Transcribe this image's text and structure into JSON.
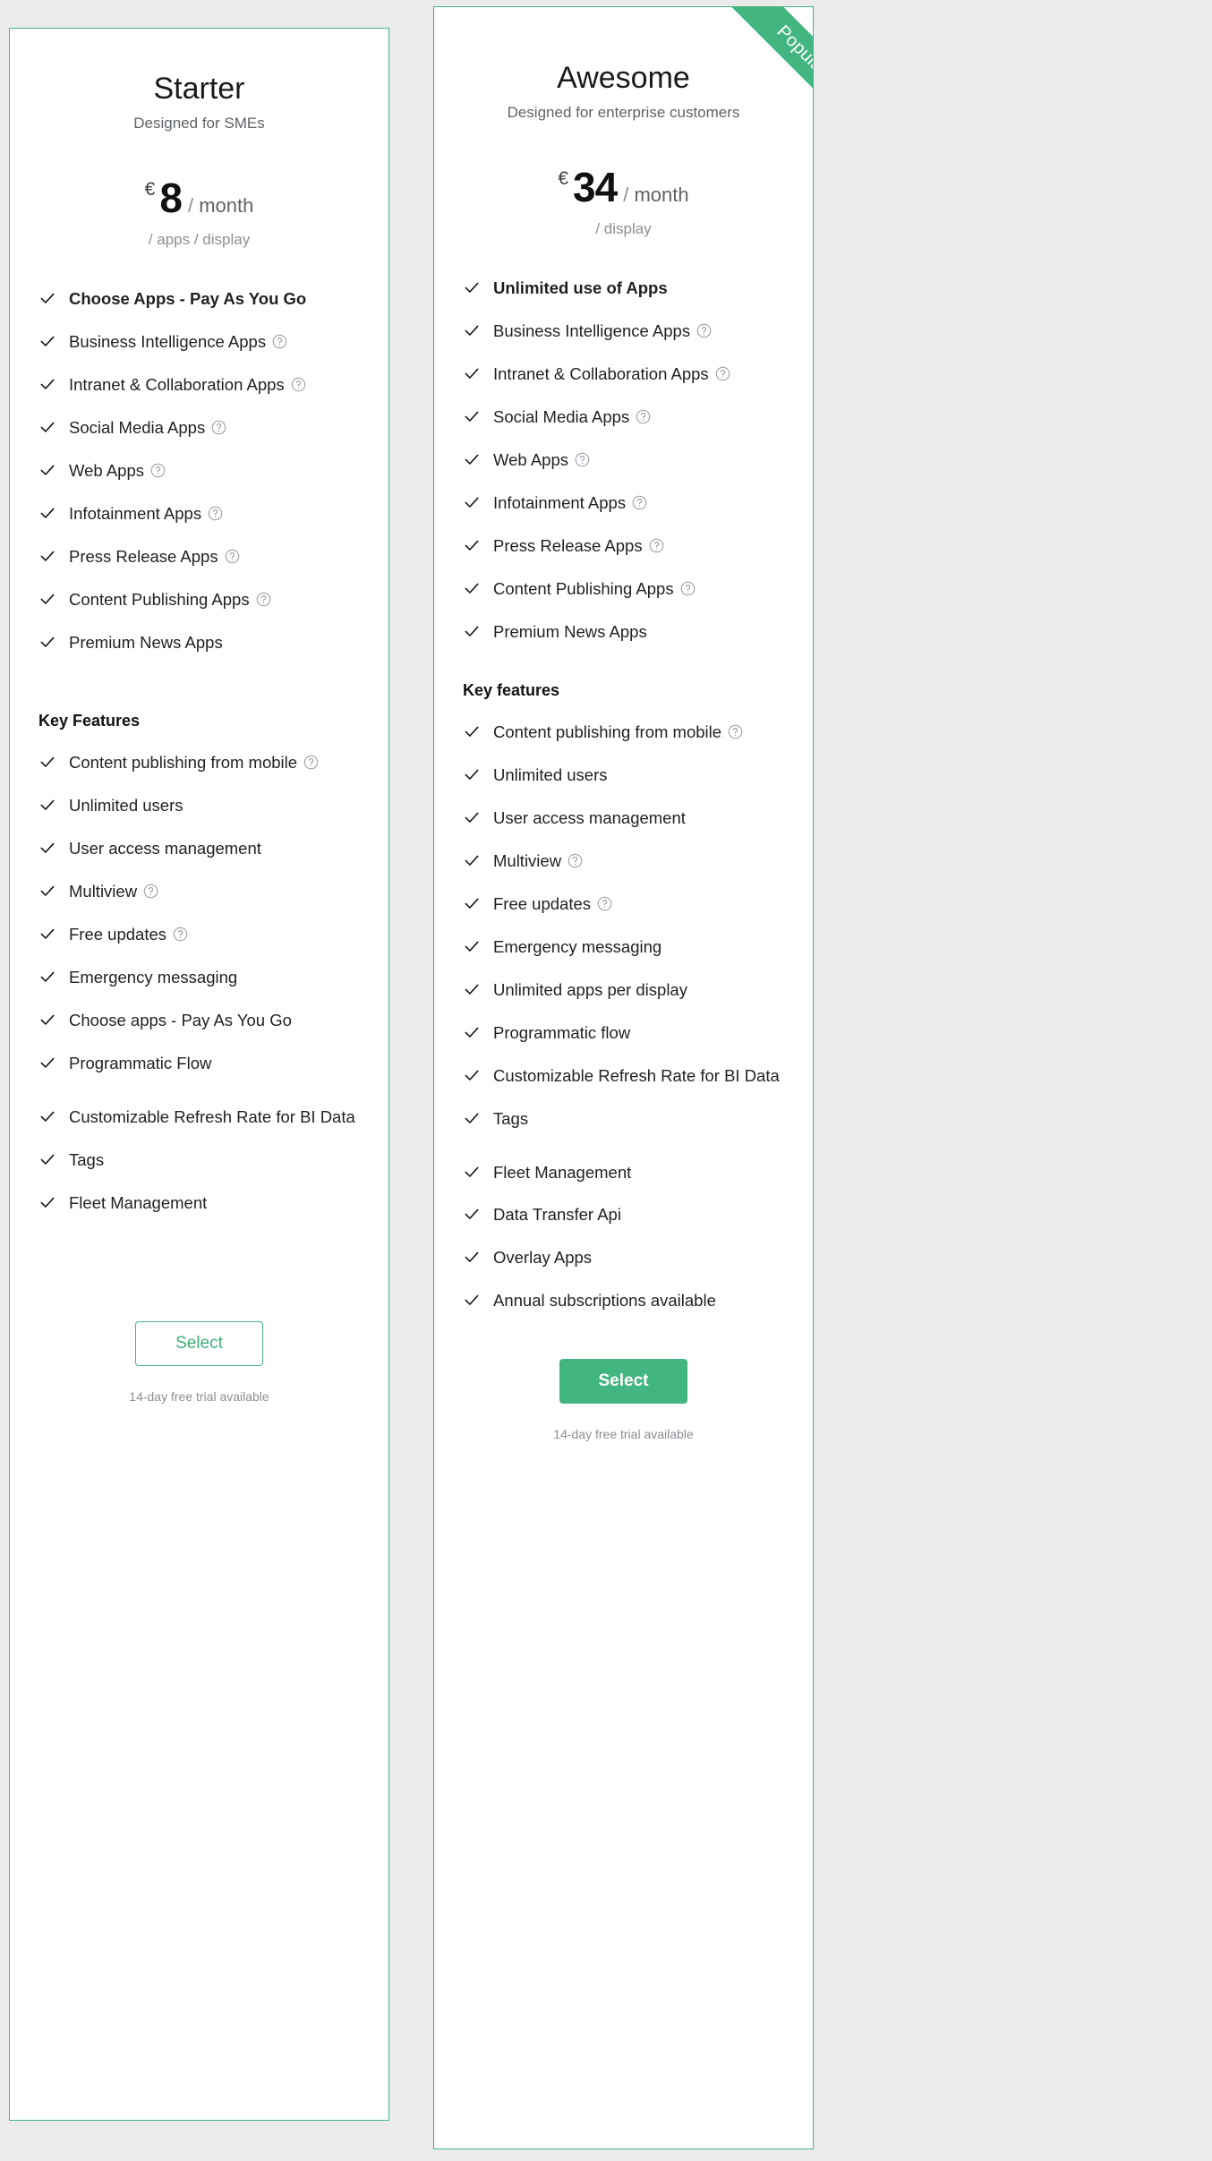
{
  "page": {
    "background_color": "#ebebeb",
    "accent_color": "#43b581"
  },
  "plans": [
    {
      "id": "starter",
      "name": "Starter",
      "tagline": "Designed for SMEs",
      "ribbon": null,
      "price": {
        "currency": "€",
        "amount": "8",
        "slash": "/",
        "period": "month",
        "note": "/ apps / display"
      },
      "apps_section": {
        "title": null,
        "items": [
          {
            "label": "Choose Apps - Pay As You Go",
            "bold": true,
            "help": false,
            "gap_before": false
          },
          {
            "label": "Business Intelligence Apps",
            "bold": false,
            "help": true,
            "gap_before": false
          },
          {
            "label": "Intranet & Collaboration Apps",
            "bold": false,
            "help": true,
            "gap_before": false
          },
          {
            "label": "Social Media Apps",
            "bold": false,
            "help": true,
            "gap_before": false
          },
          {
            "label": "Web Apps",
            "bold": false,
            "help": true,
            "gap_before": false
          },
          {
            "label": "Infotainment Apps",
            "bold": false,
            "help": true,
            "gap_before": false
          },
          {
            "label": "Press Release Apps",
            "bold": false,
            "help": true,
            "gap_before": false
          },
          {
            "label": "Content Publishing Apps",
            "bold": false,
            "help": true,
            "gap_before": false
          },
          {
            "label": "Premium News Apps",
            "bold": false,
            "help": false,
            "gap_before": false
          }
        ]
      },
      "features_section": {
        "title": "Key Features",
        "items": [
          {
            "label": "Content publishing from mobile",
            "bold": false,
            "help": true,
            "gap_before": false
          },
          {
            "label": "Unlimited users",
            "bold": false,
            "help": false,
            "gap_before": false
          },
          {
            "label": "User access management",
            "bold": false,
            "help": false,
            "gap_before": false
          },
          {
            "label": "Multiview",
            "bold": false,
            "help": true,
            "gap_before": false
          },
          {
            "label": "Free updates",
            "bold": false,
            "help": true,
            "gap_before": false
          },
          {
            "label": "Emergency messaging",
            "bold": false,
            "help": false,
            "gap_before": false
          },
          {
            "label": "Choose apps - Pay As You Go",
            "bold": false,
            "help": false,
            "gap_before": false
          },
          {
            "label": "Programmatic Flow",
            "bold": false,
            "help": false,
            "gap_before": false
          },
          {
            "label": "Customizable Refresh Rate for BI Data",
            "bold": false,
            "help": false,
            "gap_before": true
          },
          {
            "label": "Tags",
            "bold": false,
            "help": false,
            "gap_before": false
          },
          {
            "label": "Fleet Management",
            "bold": false,
            "help": false,
            "gap_before": false
          }
        ]
      },
      "cta": {
        "label": "Select",
        "style": "outline"
      },
      "trial": "14-day free trial available"
    },
    {
      "id": "awesome",
      "name": "Awesome",
      "tagline": "Designed for enterprise customers",
      "ribbon": "Popular",
      "price": {
        "currency": "€",
        "amount": "34",
        "slash": "/",
        "period": "month",
        "note": "/ display"
      },
      "apps_section": {
        "title": null,
        "items": [
          {
            "label": "Unlimited use of Apps",
            "bold": true,
            "help": false,
            "gap_before": false
          },
          {
            "label": "Business Intelligence Apps",
            "bold": false,
            "help": true,
            "gap_before": false
          },
          {
            "label": "Intranet & Collaboration Apps",
            "bold": false,
            "help": true,
            "gap_before": false
          },
          {
            "label": "Social Media Apps",
            "bold": false,
            "help": true,
            "gap_before": false
          },
          {
            "label": "Web Apps",
            "bold": false,
            "help": true,
            "gap_before": false
          },
          {
            "label": "Infotainment Apps",
            "bold": false,
            "help": true,
            "gap_before": false
          },
          {
            "label": "Press Release Apps",
            "bold": false,
            "help": true,
            "gap_before": false
          },
          {
            "label": "Content Publishing Apps",
            "bold": false,
            "help": true,
            "gap_before": false
          },
          {
            "label": "Premium News Apps",
            "bold": false,
            "help": false,
            "gap_before": false
          }
        ]
      },
      "features_section": {
        "title": "Key features",
        "items": [
          {
            "label": "Content publishing from mobile",
            "bold": false,
            "help": true,
            "gap_before": false
          },
          {
            "label": "Unlimited users",
            "bold": false,
            "help": false,
            "gap_before": false
          },
          {
            "label": "User access management",
            "bold": false,
            "help": false,
            "gap_before": false
          },
          {
            "label": "Multiview",
            "bold": false,
            "help": true,
            "gap_before": false
          },
          {
            "label": "Free updates",
            "bold": false,
            "help": true,
            "gap_before": false
          },
          {
            "label": "Emergency messaging",
            "bold": false,
            "help": false,
            "gap_before": false
          },
          {
            "label": "Unlimited apps per display",
            "bold": false,
            "help": false,
            "gap_before": false
          },
          {
            "label": "Programmatic flow",
            "bold": false,
            "help": false,
            "gap_before": false
          },
          {
            "label": "Customizable Refresh Rate for BI Data",
            "bold": false,
            "help": false,
            "gap_before": false
          },
          {
            "label": "Tags",
            "bold": false,
            "help": false,
            "gap_before": false
          },
          {
            "label": "Fleet Management",
            "bold": false,
            "help": false,
            "gap_before": true
          },
          {
            "label": "Data Transfer Api",
            "bold": false,
            "help": false,
            "gap_before": false
          },
          {
            "label": "Overlay Apps",
            "bold": false,
            "help": false,
            "gap_before": false
          },
          {
            "label": "Annual subscriptions available",
            "bold": false,
            "help": false,
            "gap_before": false
          }
        ]
      },
      "cta": {
        "label": "Select",
        "style": "solid"
      },
      "trial": "14-day free trial available"
    }
  ],
  "icons": {
    "check": "check-icon",
    "help": "help-circle-icon"
  }
}
